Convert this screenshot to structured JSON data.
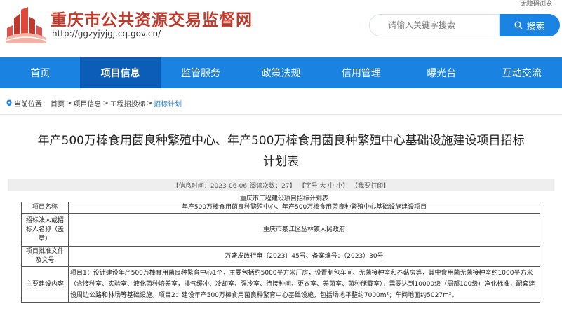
{
  "header": {
    "accessibility": "无障碍浏览",
    "site_title": "重庆市公共资源交易监督网",
    "site_url": "http://ggzyjyjgj.cq.gov.cn/",
    "search_placeholder": "请输入关键字搜索",
    "search_button": "搜索"
  },
  "nav": {
    "items": [
      "首页",
      "项目信息",
      "监管服务",
      "政策法规",
      "信用管理",
      "曝光台",
      "互动交流"
    ],
    "active_index": 1
  },
  "breadcrumb": {
    "label": "当前位置：",
    "items": [
      "首页",
      "项目信息",
      "工程招投标",
      "招标计划"
    ],
    "sep": ">"
  },
  "article": {
    "title_line1": "年产500万棒食用菌良种繁殖中心、年产500万棒食用菌良种繁殖中心基础设施建设项目招标",
    "title_line2": "计划表",
    "meta": {
      "time": "【信息时间：2023-06-06",
      "views": "阅读次数：27】",
      "font_size": "【字号 大 中 小】",
      "print": "【我要打印】"
    }
  },
  "table": {
    "caption": "重庆市工程建设项目招标计划表",
    "rows": [
      {
        "key": "项目名称",
        "value": "年产500万棒食用菌良种繁殖中心、年产500万棒食用菌良种繁殖中心基础设施建设项目"
      },
      {
        "key": "招标法人或招标人名称（盖章）",
        "value": "重庆市綦江区丛林镇人民政府"
      },
      {
        "key": "项目批准文件及文号",
        "value": "万盛发改行审〔2023〕45号、备案编号：（2023）30号"
      },
      {
        "key": "主要建设内容",
        "value": "项目1：设计建设年产500万棒食用菌良种繁育中心1个，主要包括约5000平方米厂房，设置制包车间、无菌接种室和养菇房等，其中食用菌无菌接种室约1000平方米（含接种室、实验室、液化菌种培养室，排气缓冲、冷却室、强冷室、待接种间、更衣室、养菌室、菌种储藏室），需要达到10000级（局部100级）净化标准，配套建设周边公路和林场等基础设施。项目2：建设年产500万棒食用菌良种繁育中心基础设施，包括场地平整约7000m²；车间地面约5027m²。"
      }
    ]
  },
  "colors": {
    "brand_red": "#c0392b",
    "nav_blue": "#1a83e2",
    "nav_active": "#0c5db8",
    "accent_blue": "#1b84e3"
  }
}
